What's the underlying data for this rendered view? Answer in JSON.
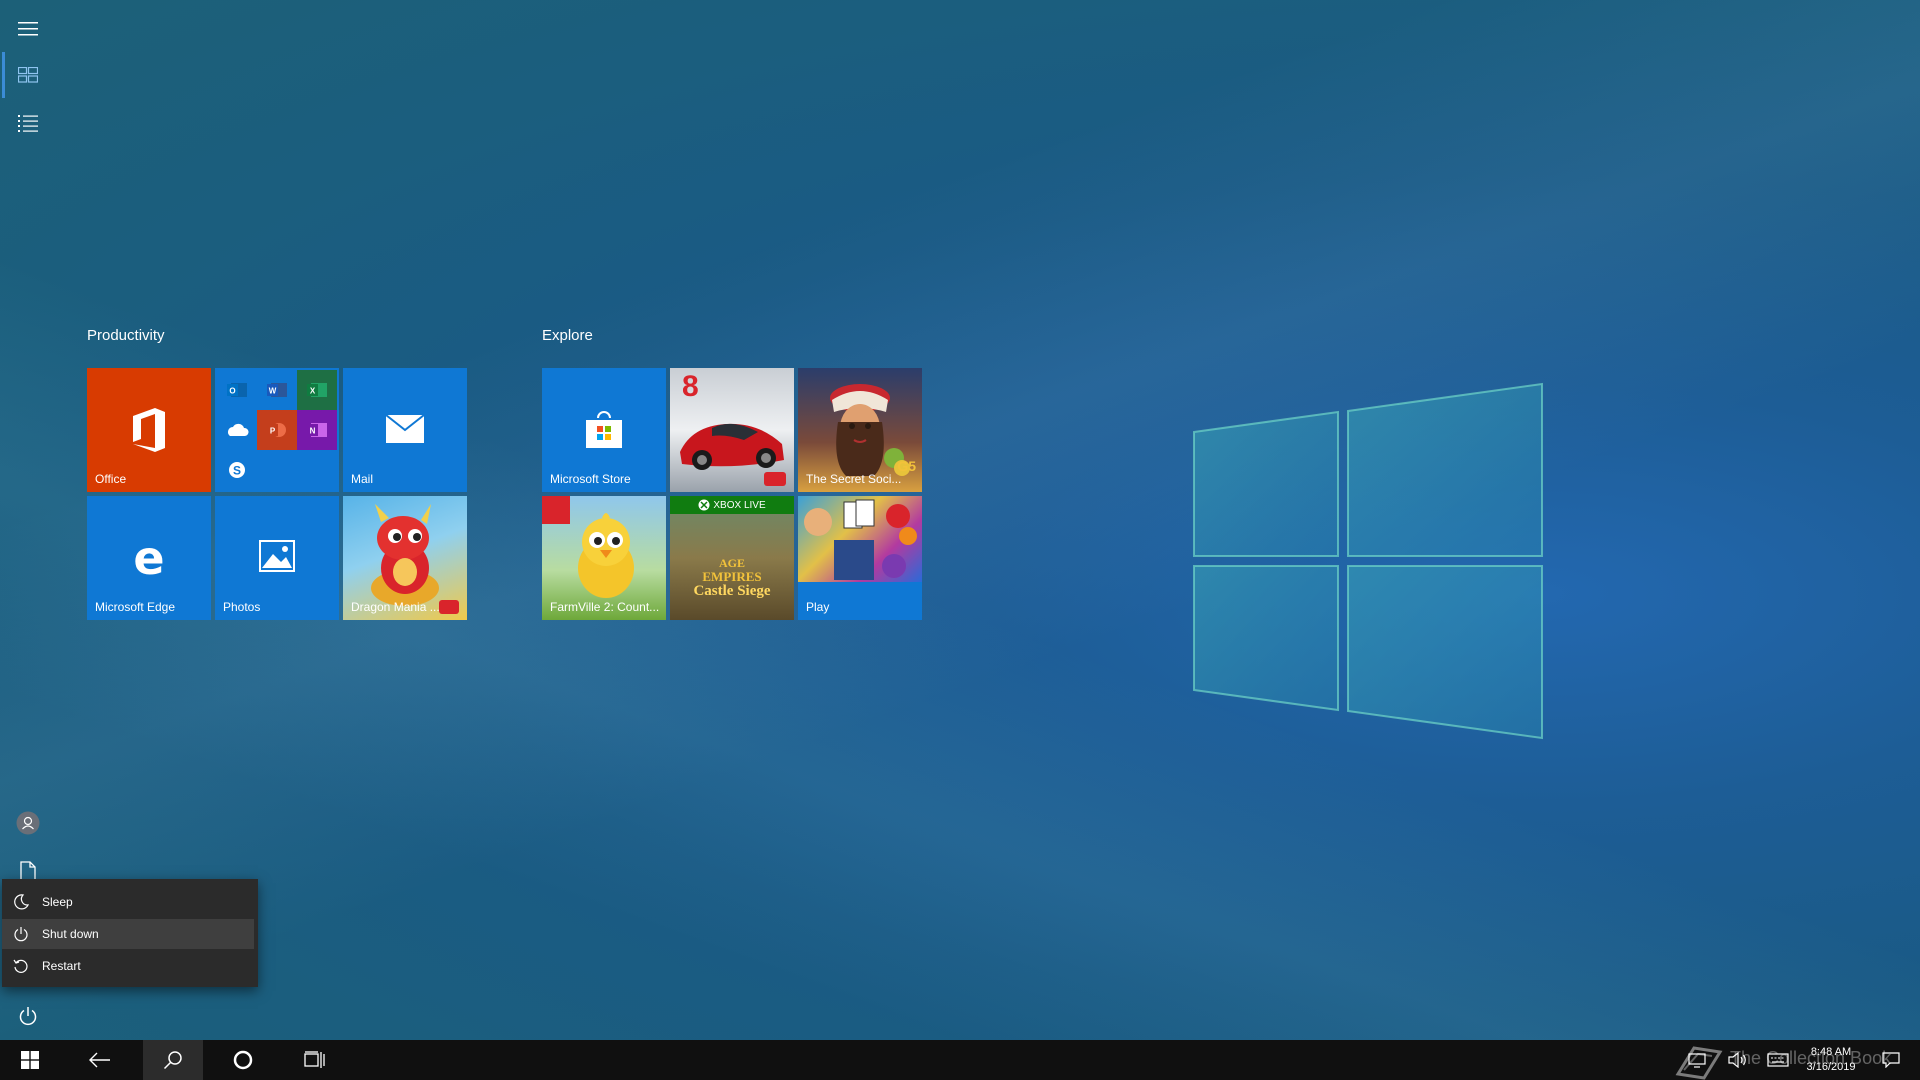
{
  "start": {
    "groups": [
      {
        "title": "Productivity",
        "tiles": [
          {
            "label": "Office",
            "icon": "office-icon"
          },
          {
            "label": "",
            "icon": "office-apps-folder-icon"
          },
          {
            "label": "Mail",
            "icon": "mail-icon"
          },
          {
            "label": "Microsoft Edge",
            "icon": "edge-icon"
          },
          {
            "label": "Photos",
            "icon": "photos-icon"
          },
          {
            "label": "Dragon Mania ...",
            "icon": "dragon-mania-icon"
          }
        ]
      },
      {
        "title": "Explore",
        "tiles": [
          {
            "label": "Microsoft Store",
            "icon": "store-icon"
          },
          {
            "label": "",
            "icon": "asphalt-8-icon",
            "badge": "8"
          },
          {
            "label": "The Secret Soci...",
            "icon": "secret-society-icon",
            "badge": "G5"
          },
          {
            "label": "FarmVille 2: Count...",
            "icon": "farmville-icon"
          },
          {
            "label": "",
            "icon": "age-of-empires-icon",
            "badge": "XBOX LIVE",
            "title_line1": "AGE",
            "title_line2": "EMPIRES",
            "title_line3": "Castle Siege"
          },
          {
            "label": "Play",
            "icon": "play-games-icon"
          }
        ]
      }
    ]
  },
  "power_menu": {
    "items": [
      "Sleep",
      "Shut down",
      "Restart"
    ],
    "hovered": "Shut down"
  },
  "taskbar": {
    "time": "8:48 AM",
    "date": "3/16/2019",
    "watermark": "The Collection Book"
  },
  "colors": {
    "office_tile": "#d83b01",
    "tile_blue": "#0f78d4",
    "taskbar": "#101010",
    "power_menu": "#2b2b2b"
  }
}
